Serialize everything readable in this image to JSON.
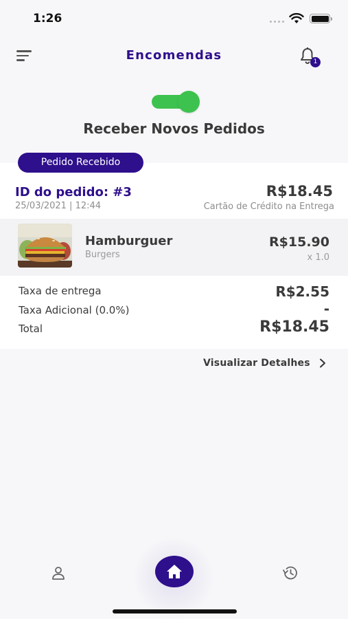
{
  "status_bar": {
    "time": "1:26"
  },
  "header": {
    "title": "Encomendas",
    "notification_count": "1"
  },
  "toggle": {
    "label": "Receber Novos Pedidos",
    "on": true,
    "color": "#3ec24f"
  },
  "order": {
    "status": "Pedido Recebido",
    "id_label": "ID do pedido: #3",
    "datetime": "25/03/2021 | 12:44",
    "total": "R$18.45",
    "payment_method": "Cartão de Crédito na Entrega",
    "items": [
      {
        "name": "Hamburguer",
        "category": "Burgers",
        "price": "R$15.90",
        "quantity": "x 1.0"
      }
    ],
    "fees": {
      "delivery_label": "Taxa de entrega",
      "delivery_value": "R$2.55",
      "additional_label": "Taxa Adicional (0.0%)",
      "additional_value": "-",
      "total_label": "Total",
      "total_value": "R$18.45"
    },
    "details_link": "Visualizar Detalhes"
  },
  "bottom_nav": {
    "items": [
      "profile-icon",
      "home-icon",
      "history-icon"
    ],
    "active": "home"
  },
  "colors": {
    "primary": "#2e0f8c",
    "toggle_green": "#3ec24f"
  }
}
